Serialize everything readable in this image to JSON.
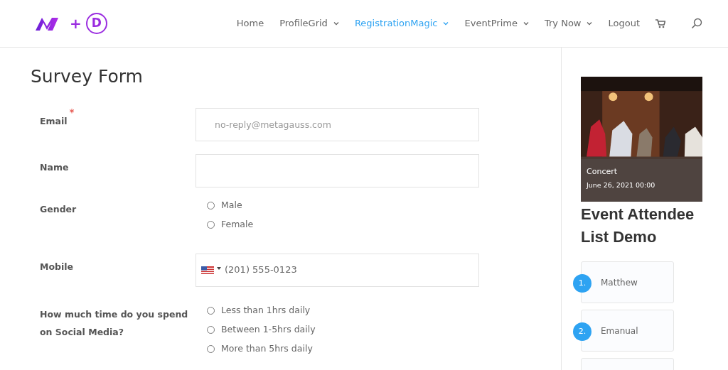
{
  "header": {
    "logo": {
      "plus": "+",
      "letter": "D"
    },
    "nav": [
      {
        "label": "Home",
        "dropdown": false,
        "selected": false
      },
      {
        "label": "ProfileGrid",
        "dropdown": true,
        "selected": false
      },
      {
        "label": "RegistrationMagic",
        "dropdown": true,
        "selected": true
      },
      {
        "label": "EventPrime",
        "dropdown": true,
        "selected": false
      },
      {
        "label": "Try Now",
        "dropdown": true,
        "selected": false
      },
      {
        "label": "Logout",
        "dropdown": false,
        "selected": false
      }
    ]
  },
  "form": {
    "title": "Survey Form",
    "fields": [
      {
        "kind": "text",
        "label": "Email",
        "required": true,
        "required_mark": "*",
        "placeholder": "no-reply@metagauss.com"
      },
      {
        "kind": "text",
        "label": "Name",
        "required": false
      },
      {
        "kind": "radio",
        "label": "Gender",
        "required": false,
        "options": [
          {
            "label": "Male",
            "selected": false
          },
          {
            "label": "Female",
            "selected": false
          }
        ]
      },
      {
        "kind": "phone",
        "label": "Mobile",
        "required": false,
        "placeholder": "(201) 555-0123"
      },
      {
        "kind": "radio",
        "label": "How much time do you spend on Social Media?",
        "required": false,
        "options": [
          {
            "label": "Less than 1hrs daily",
            "selected": false
          },
          {
            "label": "Between 1-5hrs daily",
            "selected": false
          },
          {
            "label": "More than 5hrs daily",
            "selected": false
          }
        ]
      }
    ]
  },
  "sidebar": {
    "event": {
      "kind": "picture",
      "name": "Concert",
      "date": "June 26, 2021 00:00"
    },
    "heading": "Event Attendee List Demo",
    "attendees": [
      {
        "kind": "full",
        "number": "1.",
        "name": "Matthew"
      },
      {
        "kind": "full",
        "number": "2.",
        "name": "Emanual"
      },
      {
        "kind": "partial"
      }
    ]
  }
}
